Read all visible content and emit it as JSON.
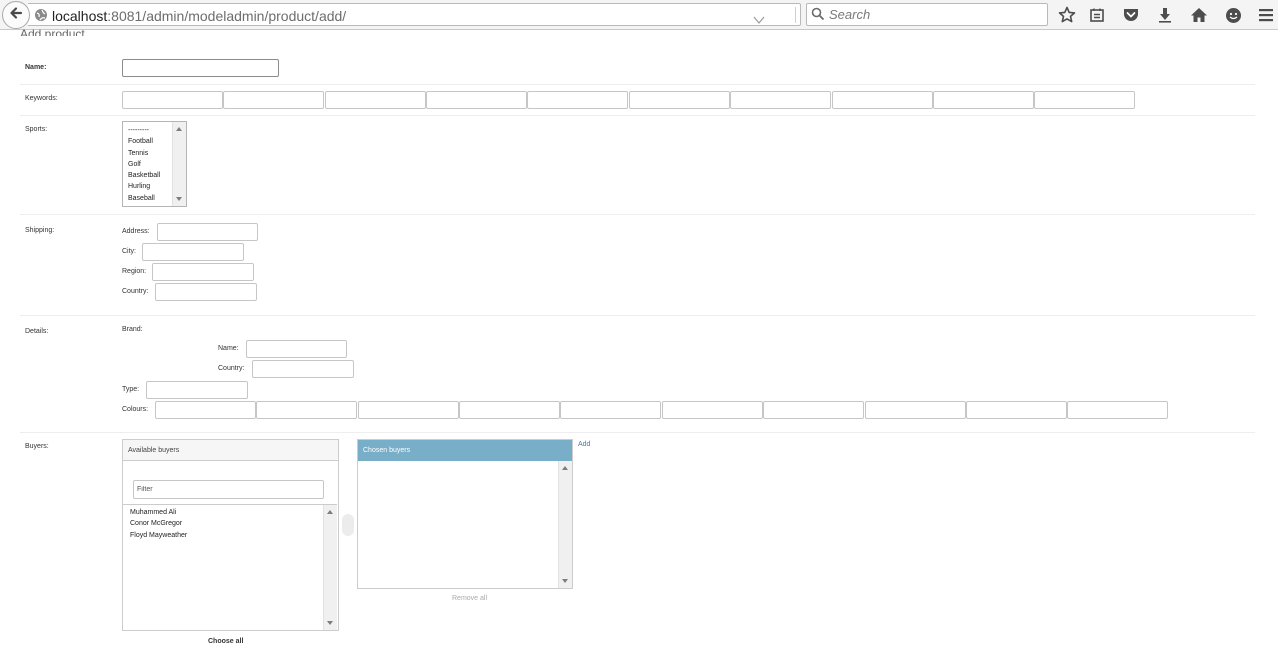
{
  "browser": {
    "url_host": "localhost",
    "url_path": ":8081/admin/modeladmin/product/add/",
    "search_placeholder": "Search"
  },
  "page": {
    "title": "Add product"
  },
  "form": {
    "name_label": "Name:",
    "keywords_label": "Keywords:",
    "sports_label": "Sports:",
    "sports_options": [
      "---------",
      "Football",
      "Tennis",
      "Golf",
      "Basketball",
      "Hurling",
      "Baseball"
    ],
    "shipping_label": "Shipping:",
    "shipping_address_label": "Address:",
    "shipping_city_label": "City:",
    "shipping_region_label": "Region:",
    "shipping_country_label": "Country:",
    "details_label": "Details:",
    "brand_label": "Brand:",
    "brand_name_label": "Name:",
    "brand_country_label": "Country:",
    "type_label": "Type:",
    "colours_label": "Colours:",
    "buyers_label": "Buyers:"
  },
  "buyers": {
    "available_title": "Available buyers",
    "filter_placeholder": "Filter",
    "available": [
      "Muhammed Ali",
      "Conor McGregor",
      "Floyd Mayweather"
    ],
    "chosen_title": "Chosen buyers",
    "add_link": "Add",
    "remove_all": "Remove all",
    "choose_all": "Choose all"
  }
}
